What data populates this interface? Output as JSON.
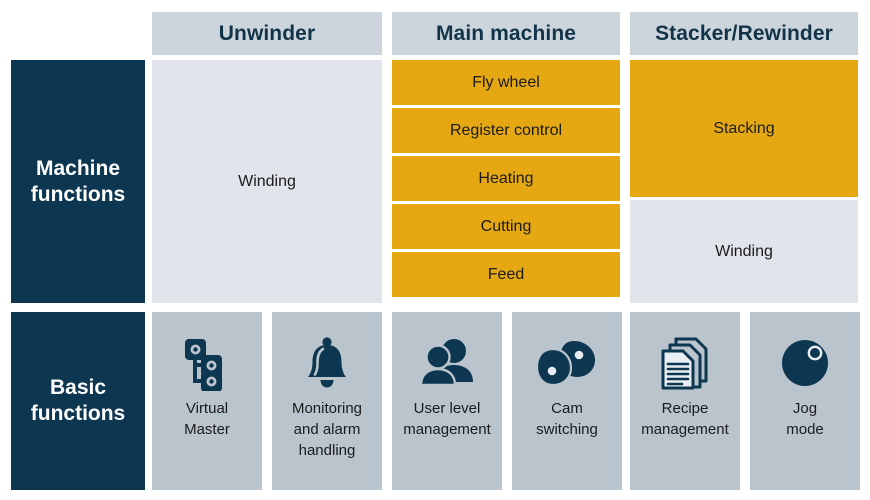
{
  "colors": {
    "navy": "#0d3650",
    "amber": "#e5a812",
    "header_grey": "#ccd5dc",
    "tile_grey": "#e1e4eb",
    "card_grey": "#b9c4cc",
    "text_dark": "#1b1b1b"
  },
  "columns": [
    {
      "id": "unwinder",
      "header": "Unwinder"
    },
    {
      "id": "main-machine",
      "header": "Main machine"
    },
    {
      "id": "stacker-rewinder",
      "header": "Stacker/Rewinder"
    }
  ],
  "rows": [
    {
      "id": "machine-functions",
      "label": "Machine\nfunctions"
    },
    {
      "id": "basic-functions",
      "label": "Basic\nfunctions"
    }
  ],
  "machine_functions": {
    "unwinder": [
      {
        "label": "Winding",
        "style": "grey"
      }
    ],
    "main_machine": [
      {
        "label": "Fly wheel",
        "style": "amber"
      },
      {
        "label": "Register control",
        "style": "amber"
      },
      {
        "label": "Heating",
        "style": "amber"
      },
      {
        "label": "Cutting",
        "style": "amber"
      },
      {
        "label": "Feed",
        "style": "amber"
      }
    ],
    "stacker_rewinder": [
      {
        "label": "Stacking",
        "style": "amber"
      },
      {
        "label": "Winding",
        "style": "grey"
      }
    ]
  },
  "basic_functions": [
    {
      "id": "virtual-master",
      "label": "Virtual\nMaster",
      "icon": "hierarchy-nodes-icon"
    },
    {
      "id": "monitoring-alarm",
      "label": "Monitoring\nand alarm\nhandling",
      "icon": "bell-icon"
    },
    {
      "id": "user-level-management",
      "label": "User level\nmanagement",
      "icon": "users-icon"
    },
    {
      "id": "cam-switching",
      "label": "Cam\nswitching",
      "icon": "cams-icon"
    },
    {
      "id": "recipe-management",
      "label": "Recipe\nmanagement",
      "icon": "documents-stack-icon"
    },
    {
      "id": "jog-mode",
      "label": "Jog\nmode",
      "icon": "jog-dial-icon"
    }
  ]
}
